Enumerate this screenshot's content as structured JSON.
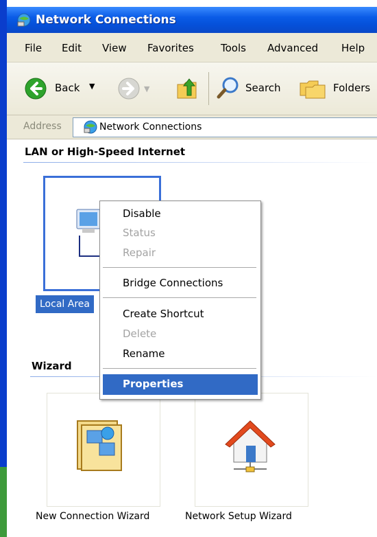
{
  "window": {
    "title": "Network Connections"
  },
  "menu": {
    "items": [
      "File",
      "Edit",
      "View",
      "Favorites",
      "Tools",
      "Advanced",
      "Help"
    ]
  },
  "toolbar": {
    "back": "Back",
    "search": "Search",
    "folders": "Folders"
  },
  "address": {
    "label": "Address",
    "value": "Network Connections"
  },
  "groups": {
    "lan": "LAN or High-Speed Internet",
    "wizard": "Wizard"
  },
  "lan_connection": {
    "label": "Local Area"
  },
  "context_menu": {
    "disable": "Disable",
    "status": "Status",
    "repair": "Repair",
    "bridge": "Bridge Connections",
    "shortcut": "Create Shortcut",
    "delete": "Delete",
    "rename": "Rename",
    "properties": "Properties"
  },
  "wizards": {
    "new_connection": "New Connection Wizard",
    "network_setup": "Network Setup Wizard"
  },
  "colors": {
    "titlebar": "#0a5be6",
    "selection": "#316ac5",
    "chrome": "#ece9d8"
  }
}
